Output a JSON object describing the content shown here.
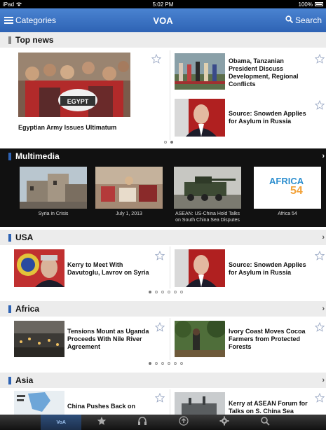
{
  "status_bar": {
    "device": "iPad",
    "time": "5:02 PM",
    "battery": "100%"
  },
  "nav": {
    "left_label": "Categories",
    "title": "VOA",
    "right_label": "Search"
  },
  "sections": {
    "top_news": {
      "title": "Top news",
      "featured": {
        "headline": "Egyptian Army Issues Ultimatum"
      },
      "items": [
        {
          "headline": "Obama, Tanzanian President Discuss Development, Regional Conflicts"
        },
        {
          "headline": "Source: Snowden Applies for Asylum in Russia"
        }
      ],
      "pages": 2,
      "active_page": 0
    },
    "multimedia": {
      "title": "Multimedia",
      "items": [
        {
          "caption": "Syria in Crisis"
        },
        {
          "caption": "July 1, 2013"
        },
        {
          "caption": "ASEAN: US-China Hold Talks on South China Sea Disputes"
        },
        {
          "caption": "Africa 54"
        }
      ],
      "logo_text": "AFRICA",
      "logo_number": "54"
    },
    "usa": {
      "title": "USA",
      "items": [
        {
          "headline": "Kerry to Meet With Davutoglu, Lavrov on Syria"
        },
        {
          "headline": "Source: Snowden Applies for Asylum in Russia"
        }
      ],
      "pages": 6,
      "active_page": 0
    },
    "africa": {
      "title": "Africa",
      "items": [
        {
          "headline": "Tensions Mount as Uganda Proceeds With Nile River Agreement"
        },
        {
          "headline": "Ivory Coast Moves Cocoa Farmers from Protected Forests"
        }
      ],
      "pages": 6,
      "active_page": 0
    },
    "asia": {
      "title": "Asia",
      "items": [
        {
          "headline": "China Pushes Back on"
        },
        {
          "headline": "Kerry at ASEAN Forum for Talks on S. China Sea"
        }
      ]
    }
  },
  "tabbar": {
    "active_label": "VoA",
    "icons": [
      "voa-logo-icon",
      "star-icon",
      "headphones-icon",
      "upload-icon",
      "gear-icon",
      "search-icon"
    ]
  },
  "colors": {
    "accent": "#2e63b4",
    "nav_top": "#4a83d1",
    "multimedia_bg": "#111111",
    "section_bg": "#ececec"
  }
}
